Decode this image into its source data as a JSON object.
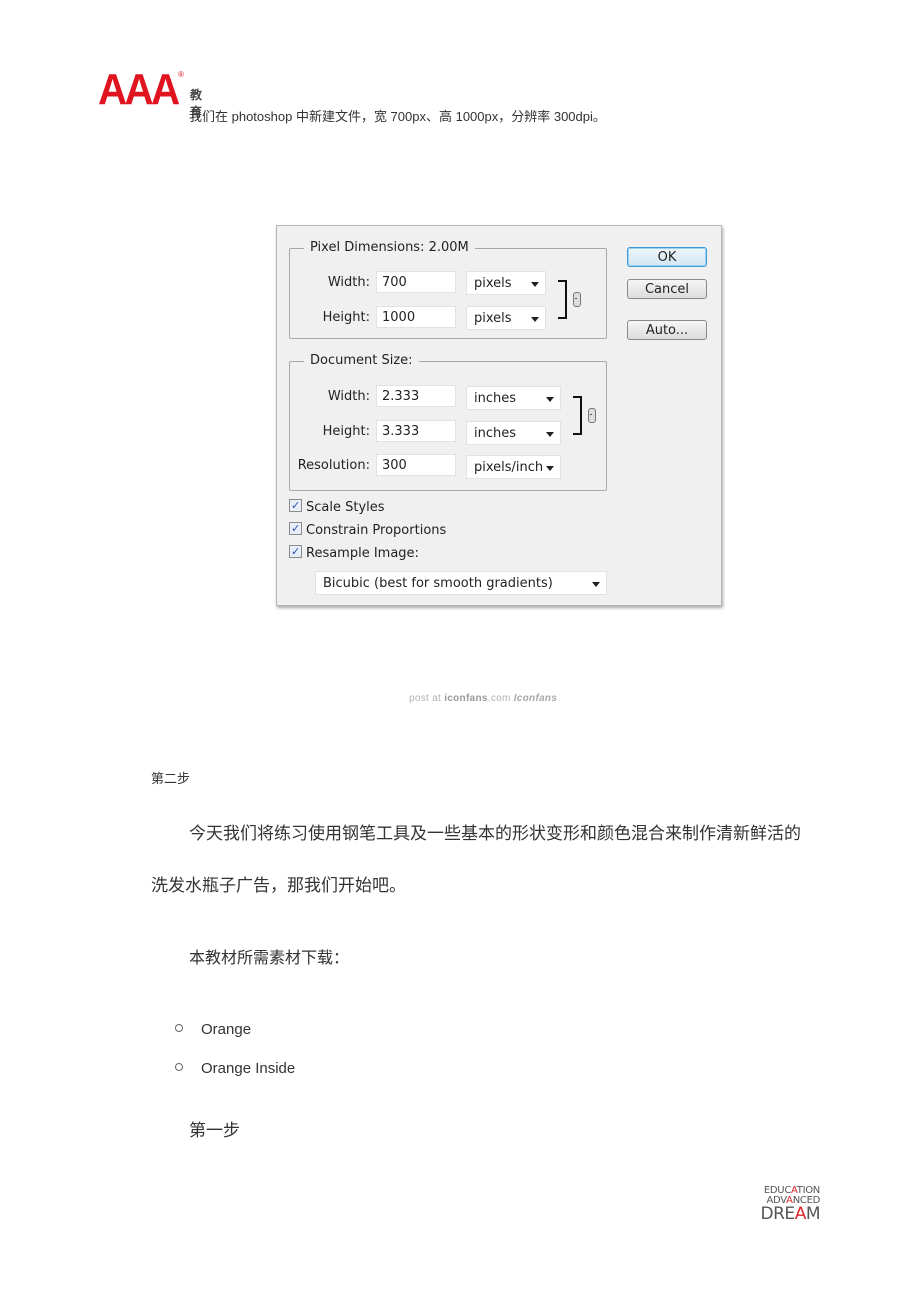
{
  "header": {
    "logo_text": "AAA",
    "logo_registered": "®",
    "logo_cn": "教育",
    "intro": "我们在 photoshop 中新建文件，宽 700px、高 1000px，分辨率 300dpi。"
  },
  "dialog": {
    "pixel_dimensions": {
      "legend": "Pixel Dimensions:  2.00M",
      "width_label": "Width:",
      "width_value": "700",
      "width_unit": "pixels",
      "height_label": "Height:",
      "height_value": "1000",
      "height_unit": "pixels"
    },
    "document_size": {
      "legend": "Document Size:",
      "width_label": "Width:",
      "width_value": "2.333",
      "width_unit": "inches",
      "height_label": "Height:",
      "height_value": "3.333",
      "height_unit": "inches",
      "resolution_label": "Resolution:",
      "resolution_value": "300",
      "resolution_unit": "pixels/inch"
    },
    "checkboxes": [
      {
        "label": "Scale Styles",
        "checked": true
      },
      {
        "label": "Constrain Proportions",
        "checked": true
      },
      {
        "label": "Resample Image:",
        "checked": true
      }
    ],
    "resample_method": "Bicubic (best for smooth gradients)",
    "buttons": {
      "ok": "OK",
      "cancel": "Cancel",
      "auto": "Auto..."
    }
  },
  "watermark": {
    "prefix": "post at ",
    "site": "iconfans",
    "suffix": ".com ",
    "logo": "Iconfans"
  },
  "content": {
    "step2_heading": "第二步",
    "paragraph_line1": "今天我们将练习使用钢笔工具及一些基本的形状变形和颜色混合来制作清新鲜活的",
    "paragraph_line2": "洗发水瓶子广告，那我们开始吧。",
    "materials_heading": "本教材所需素材下载：",
    "materials": [
      "Orange",
      "Orange Inside"
    ],
    "step1_heading": "第一步"
  },
  "footer_logo": {
    "line1_a": "EDUC",
    "line1_b": "A",
    "line1_c": "TION",
    "line2_a": "ADV",
    "line2_b": "A",
    "line2_c": "NCED",
    "line3_a": "DRE",
    "line3_b": "A",
    "line3_c": "M"
  }
}
